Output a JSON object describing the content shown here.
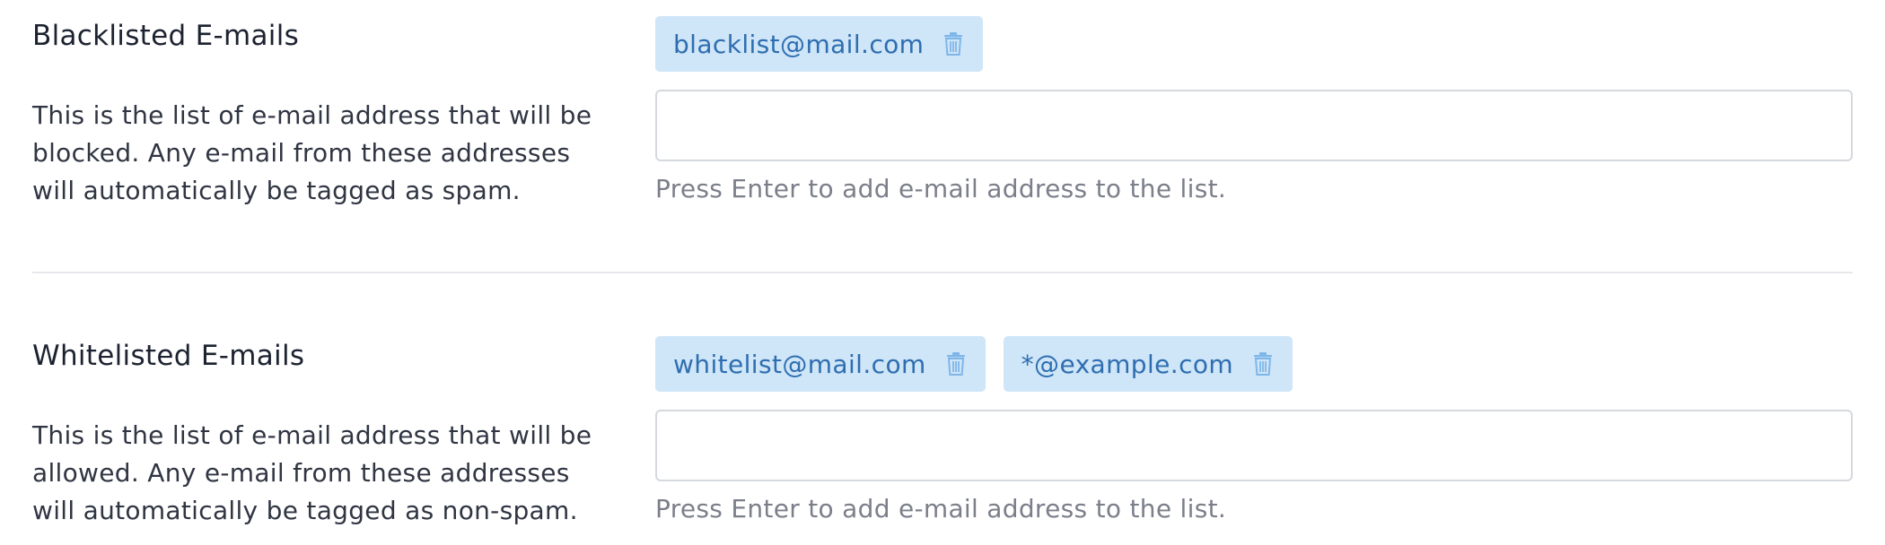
{
  "blacklist": {
    "title": "Blacklisted E-mails",
    "description": "This is the list of e-mail address that will be blocked. Any e-mail from these addresses will automatically be tagged as spam.",
    "tags": [
      {
        "label": "blacklist@mail.com",
        "icon": "trash-icon"
      }
    ],
    "input_value": "",
    "help": "Press Enter to add e-mail address to the list."
  },
  "whitelist": {
    "title": "Whitelisted E-mails",
    "description": "This is the list of e-mail address that will be allowed. Any e-mail from these addresses will automatically be tagged as non-spam.",
    "tags": [
      {
        "label": "whitelist@mail.com",
        "icon": "trash-icon"
      },
      {
        "label": "*@example.com",
        "icon": "trash-icon"
      }
    ],
    "input_value": "",
    "help": "Press Enter to add e-mail address to the list."
  },
  "colors": {
    "tag_background": "#cfe5f8",
    "tag_text": "#2e6eb0",
    "trash_icon": "#7fb6e8",
    "help_text": "#7b7f8a",
    "divider": "#e6e8eb"
  }
}
